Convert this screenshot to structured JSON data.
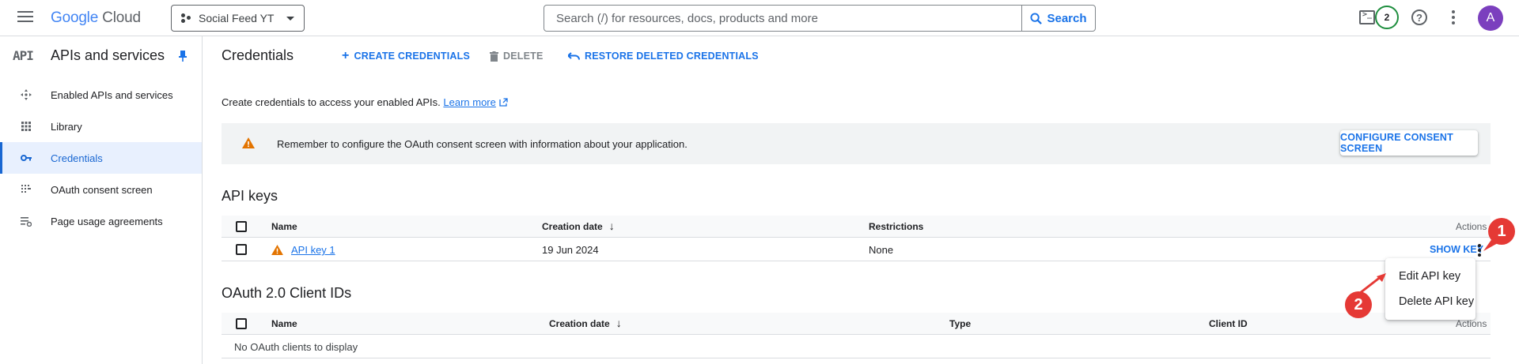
{
  "topbar": {
    "logo": {
      "google": "Google",
      "cloud": "Cloud"
    },
    "project": "Social Feed YT",
    "search_placeholder": "Search (/) for resources, docs, products and more",
    "search_button": "Search",
    "notifications_count": "2",
    "avatar_initial": "A"
  },
  "sidebar": {
    "badge": "API",
    "title": "APIs and services",
    "items": [
      {
        "label": "Enabled APIs and services",
        "icon": "apis-icon"
      },
      {
        "label": "Library",
        "icon": "library-icon"
      },
      {
        "label": "Credentials",
        "icon": "key-icon",
        "active": true
      },
      {
        "label": "OAuth consent screen",
        "icon": "consent-icon"
      },
      {
        "label": "Page usage agreements",
        "icon": "agreements-icon"
      }
    ]
  },
  "main": {
    "title": "Credentials",
    "toolbar": {
      "create": "CREATE CREDENTIALS",
      "delete": "DELETE",
      "restore": "RESTORE DELETED CREDENTIALS"
    },
    "intro": {
      "text": "Create credentials to access your enabled APIs.",
      "learn_more": "Learn more"
    },
    "banner": {
      "text": "Remember to configure the OAuth consent screen with information about your application.",
      "button": "CONFIGURE CONSENT SCREEN"
    },
    "api_keys": {
      "title": "API keys",
      "columns": {
        "name": "Name",
        "creation_date": "Creation date",
        "restrictions": "Restrictions",
        "actions": "Actions"
      },
      "rows": [
        {
          "name": "API key 1",
          "creation_date": "19 Jun 2024",
          "restrictions": "None",
          "action": "SHOW KEY"
        }
      ]
    },
    "oauth": {
      "title": "OAuth 2.0 Client IDs",
      "columns": {
        "name": "Name",
        "creation_date": "Creation date",
        "type": "Type",
        "client_id": "Client ID",
        "actions": "Actions"
      },
      "empty": "No OAuth clients to display"
    },
    "menu": {
      "edit": "Edit API key",
      "delete": "Delete API key"
    },
    "callouts": {
      "one": "1",
      "two": "2"
    }
  },
  "colors": {
    "accent": "#1a73e8",
    "warning": "#e37400",
    "callout": "#e53935",
    "active_bg": "#e8f0fe"
  }
}
